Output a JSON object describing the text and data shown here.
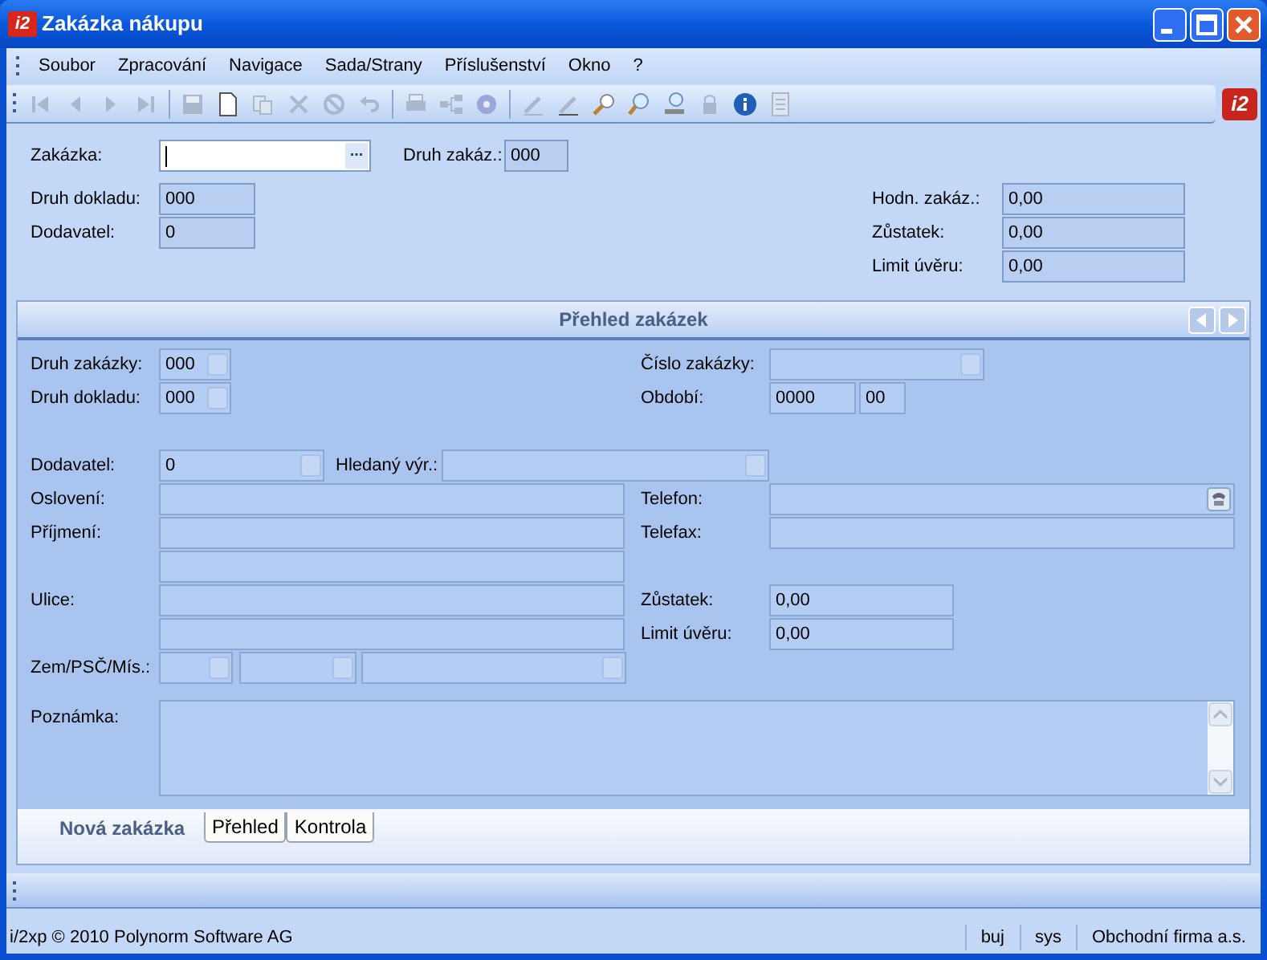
{
  "window": {
    "title": "Zakázka nákupu",
    "app_icon": "i2"
  },
  "menu": [
    "Soubor",
    "Zpracování",
    "Navigace",
    "Sada/Strany",
    "Příslušenství",
    "Okno",
    "?"
  ],
  "toolbar_logo": "i2",
  "header": {
    "order": {
      "label": "Zakázka:",
      "button": "..."
    },
    "order_type": {
      "label": "Druh zakáz.:",
      "value": "000"
    },
    "document_type": {
      "label": "Druh dokladu:",
      "value": "000"
    },
    "supplier": {
      "label": "Dodavatel:",
      "value": "0"
    },
    "order_value": {
      "label": "Hodn. zakáz.:",
      "value": "0,00"
    },
    "balance": {
      "label": "Zůstatek:",
      "value": "0,00"
    },
    "credit_limit": {
      "label": "Limit úvěru:",
      "value": "0,00"
    }
  },
  "panel": {
    "title": "Přehled zakázek",
    "order_type": {
      "label": "Druh zakázky:",
      "value": "000"
    },
    "order_number": {
      "label": "Číslo zakázky:"
    },
    "document_type": {
      "label": "Druh dokladu:",
      "value": "000"
    },
    "period": {
      "label": "Období:",
      "year": "0000",
      "month": "00"
    },
    "supplier": {
      "label": "Dodavatel:",
      "value": "0"
    },
    "search_term": {
      "label": "Hledaný výr.:"
    },
    "salutation": {
      "label": "Oslovení:"
    },
    "phone": {
      "label": "Telefon:"
    },
    "surname": {
      "label": "Příjmení:"
    },
    "fax": {
      "label": "Telefax:"
    },
    "street": {
      "label": "Ulice:"
    },
    "balance": {
      "label": "Zůstatek:",
      "value": "0,00"
    },
    "credit_limit": {
      "label": "Limit úvěru:",
      "value": "0,00"
    },
    "country_zip_city": {
      "label": "Zem/PSČ/Mís.:"
    },
    "note": {
      "label": "Poznámka:"
    }
  },
  "tabs": [
    {
      "label": "Nová zakázka",
      "selected": true
    },
    {
      "label": "Přehled",
      "selected": false
    },
    {
      "label": "Kontrola",
      "selected": false
    }
  ],
  "status_bar": [
    "i/2xp © 2010 Polynorm Software AG",
    "buj",
    "sys",
    "Obchodní firma a.s."
  ]
}
